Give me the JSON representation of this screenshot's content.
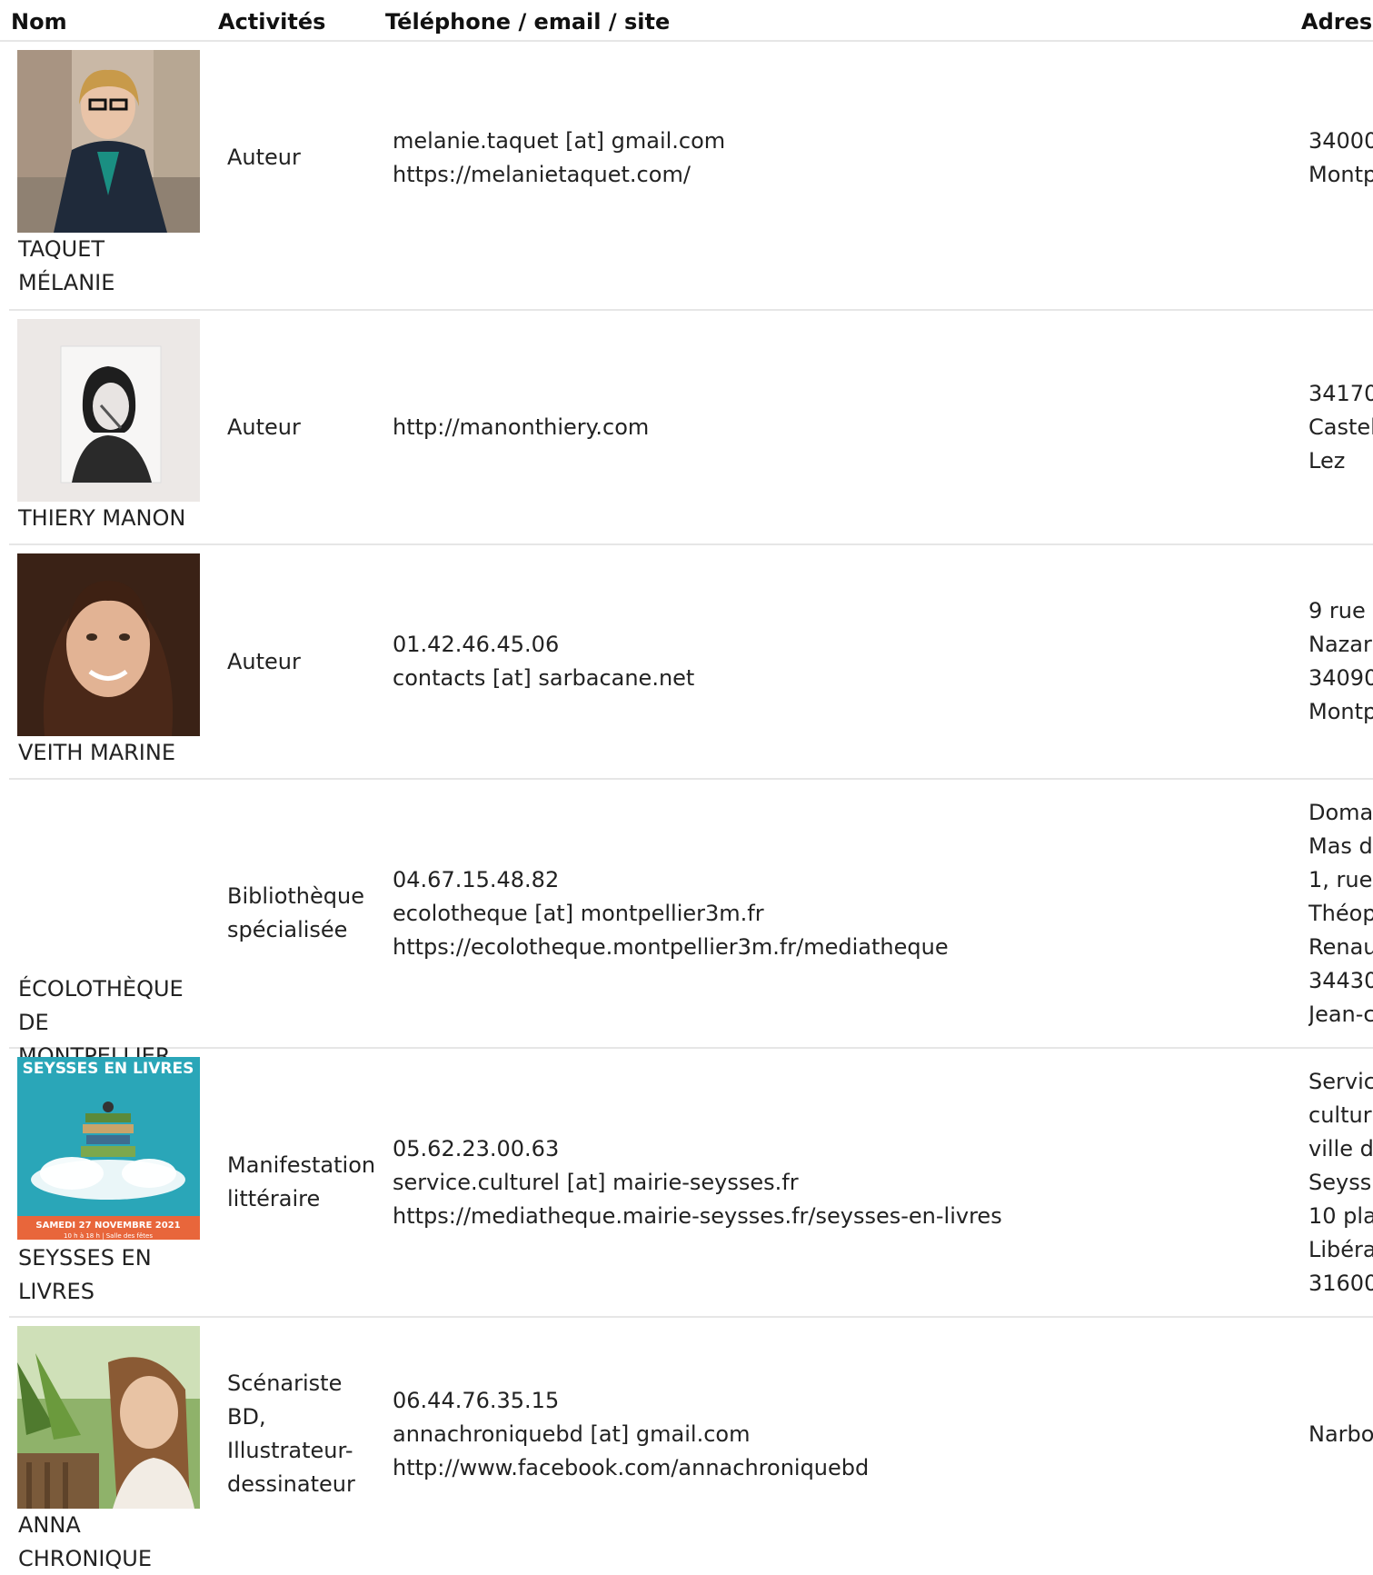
{
  "table": {
    "headers": {
      "name": "Nom",
      "activities": "Activités",
      "contact": "Téléphone / email / site",
      "address": "Adres"
    },
    "rows": [
      {
        "name": [
          "TAQUET",
          "MÉLANIE"
        ],
        "photo": "portrait-woman-glasses",
        "activities": [
          "Auteur"
        ],
        "contact": [
          "melanie.taquet [at] gmail.com",
          "https://melanietaquet.com/"
        ],
        "address": [
          "34000",
          "Montp"
        ]
      },
      {
        "name": [
          "THIERY MANON"
        ],
        "photo": "sketch-portrait",
        "activities": [
          "Auteur"
        ],
        "contact": [
          "http://manonthiery.com"
        ],
        "address": [
          "34170",
          "Castel",
          "Lez"
        ]
      },
      {
        "name": [
          "VEITH MARINE"
        ],
        "photo": "portrait-woman-smiling",
        "activities": [
          "Auteur"
        ],
        "contact": [
          "01.42.46.45.06",
          "contacts [at] sarbacane.net"
        ],
        "address": [
          "9 rue",
          "Nazar",
          "34090",
          "Montp"
        ]
      },
      {
        "name": [
          "ÉCOLOTHÈQUE",
          "DE MONTPELLIER"
        ],
        "photo": "",
        "activities": [
          "Bibliothèque",
          "spécialisée"
        ],
        "contact": [
          "04.67.15.48.82",
          "ecolotheque [at] montpellier3m.fr",
          "https://ecolotheque.montpellier3m.fr/mediatheque"
        ],
        "address": [
          "Doma",
          "Mas d",
          "1, rue",
          "Théop",
          "Renau",
          "34430",
          "Jean-c"
        ]
      },
      {
        "name": [
          "SEYSSES EN",
          "LIVRES"
        ],
        "photo": "event-poster",
        "poster": {
          "title": "SEYSSES EN LIVRES",
          "date": "SAMEDI 27 NOVEMBRE 2021",
          "sub": "10 h à 18 h | Salle des fêtes"
        },
        "activities": [
          "Manifestation",
          "littéraire"
        ],
        "contact": [
          "05.62.23.00.63",
          "service.culturel [at] mairie-seysses.fr",
          "https://mediatheque.mairie-seysses.fr/seysses-en-livres"
        ],
        "address": [
          "Servic",
          "cultur",
          "ville d",
          "Seyss",
          "10 pla",
          "Libéra",
          "31600"
        ]
      },
      {
        "name": [
          "ANNA",
          "CHRONIQUE"
        ],
        "photo": "portrait-woman-outdoor",
        "activities": [
          "Scénariste",
          "BD,",
          "Illustrateur-",
          "dessinateur"
        ],
        "contact": [
          "06.44.76.35.15",
          "annachroniquebd [at] gmail.com",
          "http://www.facebook.com/annachroniquebd"
        ],
        "address": [
          "Narbo"
        ]
      }
    ]
  },
  "colors": {
    "border": "#e6e6e6",
    "text": "#222222",
    "poster_bg": "#2aa6b8",
    "poster_band": "#e8663b"
  }
}
